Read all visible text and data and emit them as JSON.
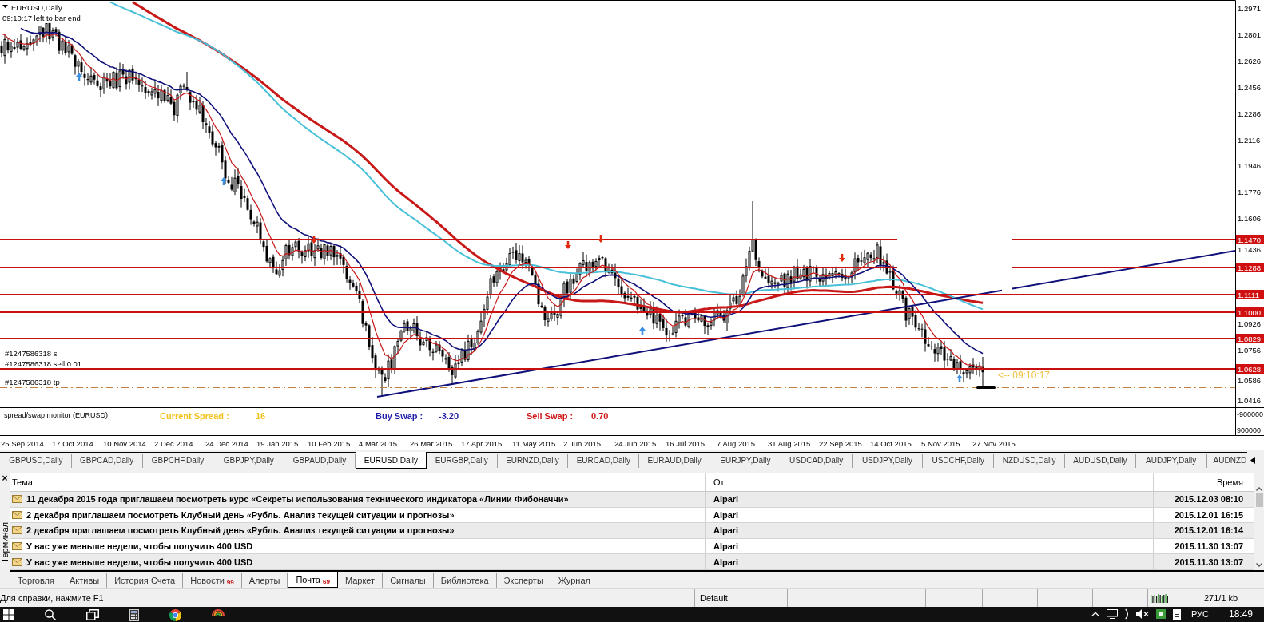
{
  "chart": {
    "title": "EURUSD,Daily",
    "timer": "09:10:17 left to bar end",
    "price_ticks": [
      "1.2971",
      "1.2801",
      "1.2626",
      "1.2456",
      "1.2286",
      "1.2116",
      "1.1946",
      "1.1776",
      "1.1606",
      "1.1436",
      "1.0926",
      "1.0756",
      "1.0586",
      "1.0416"
    ],
    "levels": [
      {
        "price_label": "1.1470"
      },
      {
        "price_label": "1.1288"
      },
      {
        "price_label": "1.1111"
      },
      {
        "price_label": "1.1000"
      },
      {
        "price_label": "1.0829"
      }
    ],
    "orders": [
      {
        "kind": "stop_loss",
        "label": "#1247586318 sl"
      },
      {
        "kind": "entry",
        "label": "#1247586318 sell 0.01",
        "price_label": "1.0628"
      },
      {
        "kind": "take_profit",
        "label": "#1247586318 tp"
      }
    ],
    "countdown": "<-- 09:10:17",
    "dates": [
      "25 Sep 2014",
      "17 Oct 2014",
      "10 Nov 2014",
      "2 Dec 2014",
      "24 Dec 2014",
      "19 Jan 2015",
      "10 Feb 2015",
      "4 Mar 2015",
      "26 Mar 2015",
      "17 Apr 2015",
      "11 May 2015",
      "2 Jun 2015",
      "24 Jun 2015",
      "16 Jul 2015",
      "7 Aug 2015",
      "31 Aug 2015",
      "22 Sep 2015",
      "14 Oct 2015",
      "5 Nov 2015",
      "27 Nov 2015"
    ]
  },
  "indicator": {
    "title": "spread/swap monitor (EURUSD)",
    "items": [
      {
        "label": "Current Spread :",
        "value": "16",
        "color": "#f2c21b"
      },
      {
        "label": "Buy Swap :",
        "value": "-3.20",
        "color": "#1c1ca8"
      },
      {
        "label": "Sell Swap :",
        "value": "0.70",
        "color": "#d01515"
      }
    ],
    "scale_ticks": [
      "-900000",
      "900000"
    ]
  },
  "chart_tabs": [
    {
      "label": "GBPUSD,Daily",
      "selected": false
    },
    {
      "label": "GBPCAD,Daily",
      "selected": false
    },
    {
      "label": "GBPCHF,Daily",
      "selected": false
    },
    {
      "label": "GBPJPY,Daily",
      "selected": false
    },
    {
      "label": "GBPAUD,Daily",
      "selected": false
    },
    {
      "label": "EURUSD,Daily",
      "selected": true
    },
    {
      "label": "EURGBP,Daily",
      "selected": false
    },
    {
      "label": "EURNZD,Daily",
      "selected": false
    },
    {
      "label": "EURCAD,Daily",
      "selected": false
    },
    {
      "label": "EURAUD,Daily",
      "selected": false
    },
    {
      "label": "EURJPY,Daily",
      "selected": false
    },
    {
      "label": "USDCAD,Daily",
      "selected": false
    },
    {
      "label": "USDJPY,Daily",
      "selected": false
    },
    {
      "label": "USDCHF,Daily",
      "selected": false
    },
    {
      "label": "NZDUSD,Daily",
      "selected": false
    },
    {
      "label": "AUDUSD,Daily",
      "selected": false
    },
    {
      "label": "AUDJPY,Daily",
      "selected": false
    },
    {
      "label": "AUDNZD",
      "selected": false
    }
  ],
  "terminal": {
    "title": "Терминал",
    "close": "×",
    "columns": [
      "Тема",
      "От",
      "Время"
    ],
    "rows": [
      {
        "subject": "11 декабря 2015 года приглашаем посмотреть курс «Секреты использования технического индикатора «Линии Фибоначчи»",
        "sender": "Alpari",
        "time": "2015.12.03 08:10",
        "unread": true
      },
      {
        "subject": "2 декабря приглашаем посмотреть Клубный день «Рубль. Анализ текущей ситуации и прогнозы»",
        "sender": "Alpari",
        "time": "2015.12.01 16:15",
        "unread": true
      },
      {
        "subject": "2 декабря приглашаем посмотреть Клубный день «Рубль. Анализ текущей ситуации и прогнозы»",
        "sender": "Alpari",
        "time": "2015.12.01 16:14",
        "unread": true
      },
      {
        "subject": "У вас уже меньше недели, чтобы получить 400 USD",
        "sender": "Alpari",
        "time": "2015.11.30 13:07",
        "unread": true
      },
      {
        "subject": "У вас уже меньше недели, чтобы получить 400 USD",
        "sender": "Alpari",
        "time": "2015.11.30 13:07",
        "unread": true
      }
    ],
    "tabs": [
      {
        "label": "Торговля",
        "selected": false
      },
      {
        "label": "Активы",
        "selected": false
      },
      {
        "label": "История Счета",
        "selected": false
      },
      {
        "label": "Новости",
        "badge": "99",
        "selected": false
      },
      {
        "label": "Алерты",
        "selected": false
      },
      {
        "label": "Почта",
        "badge": "69",
        "selected": true
      },
      {
        "label": "Маркет",
        "selected": false
      },
      {
        "label": "Сигналы",
        "selected": false
      },
      {
        "label": "Библиотека",
        "selected": false
      },
      {
        "label": "Эксперты",
        "selected": false
      },
      {
        "label": "Журнал",
        "selected": false
      }
    ]
  },
  "status_bar": {
    "help": "Для справки, нажмите F1",
    "profile": "Default",
    "traffic": "271/1 kb"
  },
  "taskbar": {
    "language": "РУС",
    "clock": "18:49"
  }
}
